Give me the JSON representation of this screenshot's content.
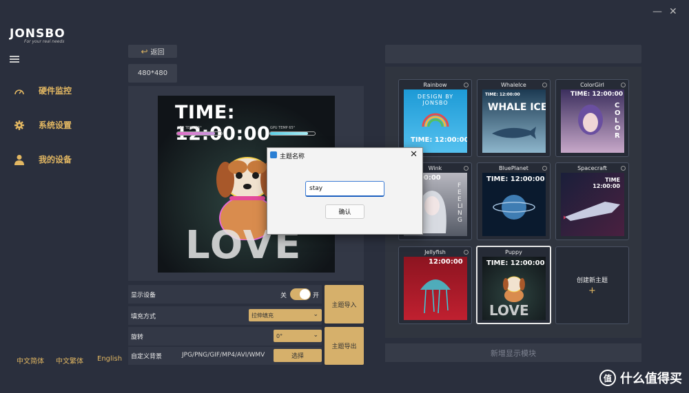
{
  "window": {
    "minimize": "—",
    "close": "✕"
  },
  "brand": {
    "name": "JONSBO",
    "tagline": "For your real needs"
  },
  "nav": [
    {
      "label": "硬件监控",
      "icon": "gauge-icon"
    },
    {
      "label": "系统设置",
      "icon": "gear-icon"
    },
    {
      "label": "我的设备",
      "icon": "user-icon"
    }
  ],
  "languages": [
    "中文简体",
    "中文繁体",
    "English"
  ],
  "toolbar": {
    "back_label": "返回",
    "resolution": "480*480"
  },
  "preview": {
    "time": "TIME: 12:00:00",
    "cpu_label": "CPU TEMP 65°",
    "gpu_label": "GPU TEMP 65°",
    "cpu_fill": 0.85,
    "gpu_fill": 0.85,
    "caption": "LOVE"
  },
  "settings": {
    "display_device_label": "显示设备",
    "toggle_off": "关",
    "toggle_on": "开",
    "toggle_state": "on",
    "fill_mode_label": "填充方式",
    "fill_mode_value": "拉伸填充",
    "rotation_label": "旋转",
    "rotation_value": "0°",
    "custom_bg_label": "自定义背景",
    "custom_bg_formats": "JPG/PNG/GIF/MP4/AVI/WMV",
    "choose_label": "选择",
    "import_label": "主题导入",
    "export_label": "主题导出"
  },
  "themes": [
    {
      "name": "Rainbow",
      "time": "TIME: 12:00:00",
      "extra": "DESIGN BY JONSBO",
      "colors": [
        "#1d9ad6",
        "#55c1ef"
      ]
    },
    {
      "name": "WhaleIce",
      "time": "TIME: 12:00:00",
      "extra": "WHALE ICE",
      "colors": [
        "#1c3a52",
        "#8eb6cc"
      ]
    },
    {
      "name": "ColorGirl",
      "time": "TIME: 12:00:00",
      "extra": "COLOR",
      "colors": [
        "#3c2f5e",
        "#c7a8c9"
      ]
    },
    {
      "name": "Wink",
      "time": "12:00:00",
      "extra": "FEELING",
      "colors": [
        "#b8b8c0",
        "#555a66"
      ]
    },
    {
      "name": "BluePlanet",
      "time": "TIME: 12:00:00",
      "extra": "",
      "colors": [
        "#0a1a2e",
        "#3f7db3"
      ]
    },
    {
      "name": "Spacecraft",
      "time": "TIME 12:00:00",
      "extra": "",
      "colors": [
        "#1a1f3a",
        "#c63a5a"
      ]
    },
    {
      "name": "Jellyfish",
      "time": "12:00:00",
      "extra": "",
      "colors": [
        "#8c1420",
        "#3ad1e0"
      ]
    },
    {
      "name": "Puppy",
      "time": "TIME: 12:00:00",
      "extra": "LOVE",
      "colors": [
        "#112020",
        "#c88a4a"
      ]
    }
  ],
  "create_theme": {
    "label": "创建新主题",
    "plus": "+"
  },
  "add_module_label": "新增显示模块",
  "dialog": {
    "title": "主题名称",
    "input_value": "stay",
    "ok_label": "确认",
    "close": "✕"
  },
  "watermark": {
    "text": "什么值得买",
    "symbol": "值"
  },
  "colors": {
    "accent": "#e2b762",
    "button_gold": "#d6b06b",
    "background": "#2a2f3d"
  }
}
